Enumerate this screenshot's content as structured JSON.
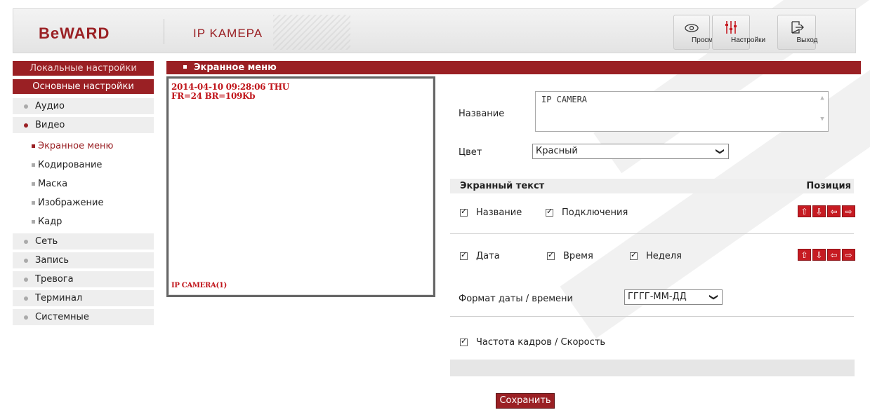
{
  "header": {
    "logo": "BeWARD",
    "subtitle": "IP KAMEPA",
    "buttons": [
      {
        "label": "Просмотр",
        "icon": "eye-icon"
      },
      {
        "label": "Настройки",
        "icon": "sliders-icon"
      },
      {
        "label": "Выход",
        "icon": "exit-icon"
      }
    ]
  },
  "sidebar": {
    "local": "Локальные настройки",
    "basic": "Основные настройки",
    "items": [
      "Аудио",
      "Видео"
    ],
    "video_sub": [
      "Экранное меню",
      "Кодирование",
      "Маска",
      "Изображение",
      "Кадр"
    ],
    "items2": [
      "Сеть",
      "Запись",
      "Тревога",
      "Терминал",
      "Системные"
    ]
  },
  "content": {
    "title": "Экранное меню",
    "preview": {
      "line1": "2014-04-10 09:28:06 THU",
      "line2": "FR=24 BR=109Kb",
      "bottom": "IP CAMERA(1)"
    },
    "form": {
      "name_label": "Название",
      "name_value": "IP CAMERA",
      "color_label": "Цвет",
      "color_value": "Красный",
      "section_left": "Экранный текст",
      "section_right": "Позиция",
      "cb_name": "Название",
      "cb_connections": "Подключения",
      "cb_date": "Дата",
      "cb_time": "Время",
      "cb_week": "Неделя",
      "datefmt_label": "Формат даты / времени",
      "datefmt_value": "ГГГГ-ММ-ДД",
      "cb_framerate": "Частота кадров / Скорость",
      "save": "Сохранить"
    }
  },
  "colors": {
    "brand": "#9a2024",
    "arrow": "#c61b22"
  }
}
